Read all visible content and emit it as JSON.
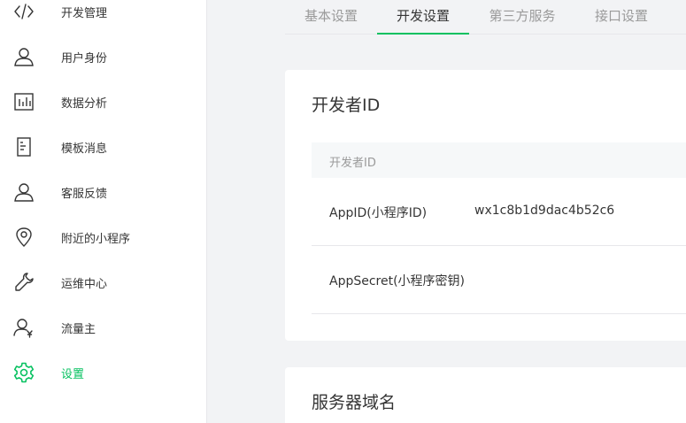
{
  "sidebar": {
    "items": [
      {
        "label": "开发管理",
        "icon": "code-icon"
      },
      {
        "label": "用户身份",
        "icon": "user-icon"
      },
      {
        "label": "数据分析",
        "icon": "chart-icon"
      },
      {
        "label": "模板消息",
        "icon": "document-icon"
      },
      {
        "label": "客服反馈",
        "icon": "user-feedback-icon"
      },
      {
        "label": "附近的小程序",
        "icon": "location-pin-icon"
      },
      {
        "label": "运维中心",
        "icon": "wrench-icon"
      },
      {
        "label": "流量主",
        "icon": "user-yuan-icon"
      },
      {
        "label": "设置",
        "icon": "gear-icon",
        "active": true
      }
    ]
  },
  "tabs": [
    {
      "label": "基本设置"
    },
    {
      "label": "开发设置",
      "active": true
    },
    {
      "label": "第三方服务"
    },
    {
      "label": "接口设置"
    }
  ],
  "developer_id_card": {
    "title": "开发者ID",
    "table_header": "开发者ID",
    "rows": [
      {
        "label": "AppID(小程序ID)",
        "value": "wx1c8b1d9dac4b52c6"
      },
      {
        "label": "AppSecret(小程序密钥)",
        "value": ""
      }
    ]
  },
  "server_domain_card": {
    "title": "服务器域名"
  },
  "colors": {
    "accent": "#07c160",
    "background": "#f2f3f5",
    "text": "#353535",
    "muted": "#9a9a9a",
    "border": "#e7e7eb"
  }
}
